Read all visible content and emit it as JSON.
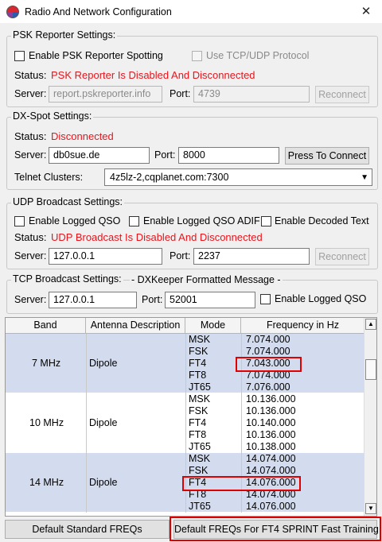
{
  "window": {
    "title": "Radio And Network Configuration",
    "close_glyph": "✕"
  },
  "psk": {
    "legend": "PSK Reporter Settings:",
    "enable_label": "Enable PSK Reporter Spotting",
    "tcp_label": "Use TCP/UDP Protocol",
    "status_label": "Status:",
    "status_value": "PSK Reporter Is Disabled And Disconnected",
    "server_label": "Server:",
    "server_value": "report.pskreporter.info",
    "port_label": "Port:",
    "port_value": "4739",
    "reconnect_label": "Reconnect"
  },
  "dx": {
    "legend": "DX-Spot Settings:",
    "status_label": "Status:",
    "status_value": "Disconnected",
    "server_label": "Server:",
    "server_value": "db0sue.de",
    "port_label": "Port:",
    "port_value": "8000",
    "connect_label": "Press To Connect",
    "telnet_label": "Telnet Clusters:",
    "telnet_value": "4z5lz-2,cqplanet.com:7300"
  },
  "udp": {
    "legend": "UDP Broadcast Settings:",
    "logged_qso_label": "Enable Logged QSO",
    "logged_adif_label": "Enable Logged QSO ADIF",
    "decoded_label": "Enable Decoded Text",
    "status_label": "Status:",
    "status_value": "UDP Broadcast Is Disabled And Disconnected",
    "server_label": "Server:",
    "server_value": "127.0.0.1",
    "port_label": "Port:",
    "port_value": "2237",
    "reconnect_label": "Reconnect"
  },
  "tcp": {
    "legend": "TCP Broadcast Settings:",
    "note": "- DXKeeper Formatted Message -",
    "server_label": "Server:",
    "server_value": "127.0.0.1",
    "port_label": "Port:",
    "port_value": "52001",
    "logged_qso_label": "Enable Logged QSO"
  },
  "table": {
    "headers": [
      "Band",
      "Antenna Description",
      "Mode",
      "Frequency in Hz"
    ],
    "bands": [
      {
        "band": "7 MHz",
        "antenna": "Dipole",
        "modes": [
          "MSK",
          "FSK",
          "FT4",
          "FT8",
          "JT65"
        ],
        "freqs": [
          "7.074.000",
          "7.074.000",
          "7.043.000",
          "7.074.000",
          "7.076.000"
        ]
      },
      {
        "band": "10 MHz",
        "antenna": "Dipole",
        "modes": [
          "MSK",
          "FSK",
          "FT4",
          "FT8",
          "JT65"
        ],
        "freqs": [
          "10.136.000",
          "10.136.000",
          "10.140.000",
          "10.136.000",
          "10.138.000"
        ]
      },
      {
        "band": "14 MHz",
        "antenna": "Dipole",
        "modes": [
          "MSK",
          "FSK",
          "FT4",
          "FT8",
          "JT65"
        ],
        "freqs": [
          "14.074.000",
          "14.074.000",
          "14.076.000",
          "14.074.000",
          "14.076.000"
        ]
      }
    ]
  },
  "buttons": {
    "default_standard": "Default Standard FREQs",
    "default_ft4": "Default FREQs For FT4 SPRINT Fast Training"
  },
  "colors": {
    "status_red": "#e8141c",
    "highlight_red": "#e00000",
    "selected_row": "#d3dcef"
  }
}
